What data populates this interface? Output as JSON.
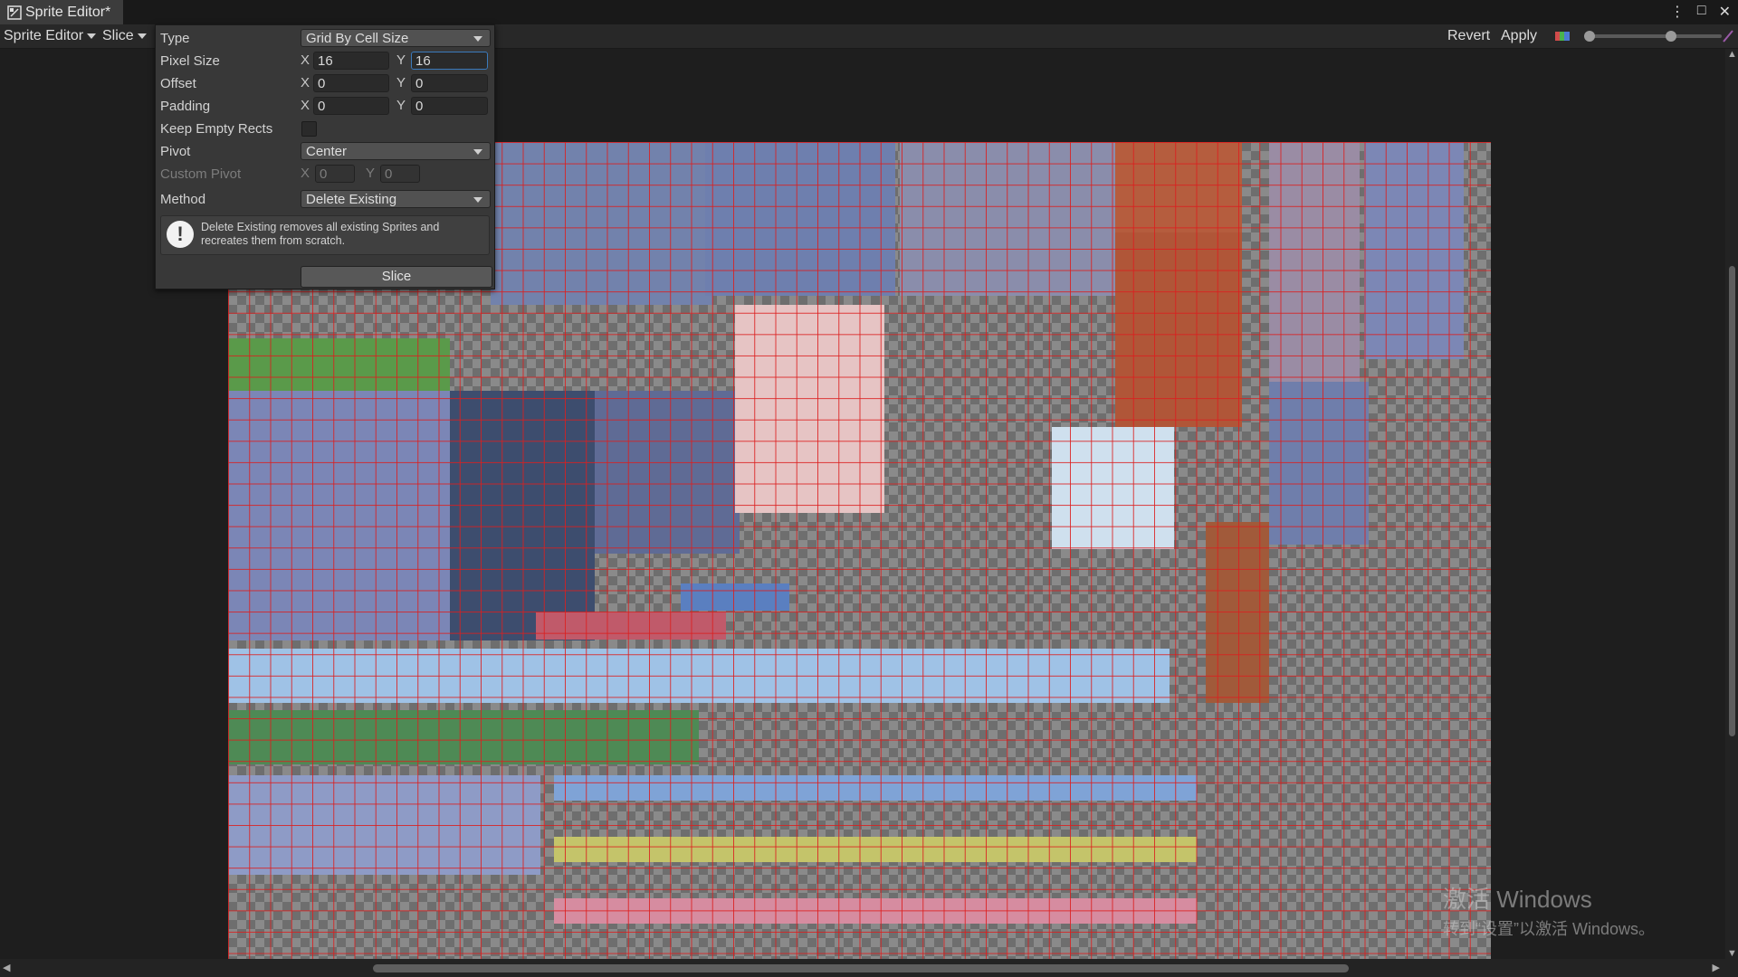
{
  "window": {
    "tab_title": "Sprite Editor*",
    "controls": [
      "⋮",
      "□",
      "✕"
    ]
  },
  "toolbar": {
    "sprite_editor_menu": "Sprite Editor",
    "slice_menu": "Slice",
    "revert": "Revert",
    "apply": "Apply"
  },
  "slice_panel": {
    "type_label": "Type",
    "type_value": "Grid By Cell Size",
    "pixel_size_label": "Pixel Size",
    "pixel_size_x": "16",
    "pixel_size_y": "16",
    "offset_label": "Offset",
    "offset_x": "0",
    "offset_y": "0",
    "padding_label": "Padding",
    "padding_x": "0",
    "padding_y": "0",
    "keep_empty_label": "Keep Empty Rects",
    "keep_empty_checked": false,
    "pivot_label": "Pivot",
    "pivot_value": "Center",
    "custom_pivot_label": "Custom Pivot",
    "custom_pivot_x": "0",
    "custom_pivot_y": "0",
    "method_label": "Method",
    "method_value": "Delete Existing",
    "help_text": "Delete Existing removes all existing Sprites and recreates them from scratch.",
    "slice_button": "Slice",
    "x_label": "X",
    "y_label": "Y"
  },
  "watermark": {
    "line1": "激活 Windows",
    "line2": "转到“设置”以激活 Windows。"
  }
}
